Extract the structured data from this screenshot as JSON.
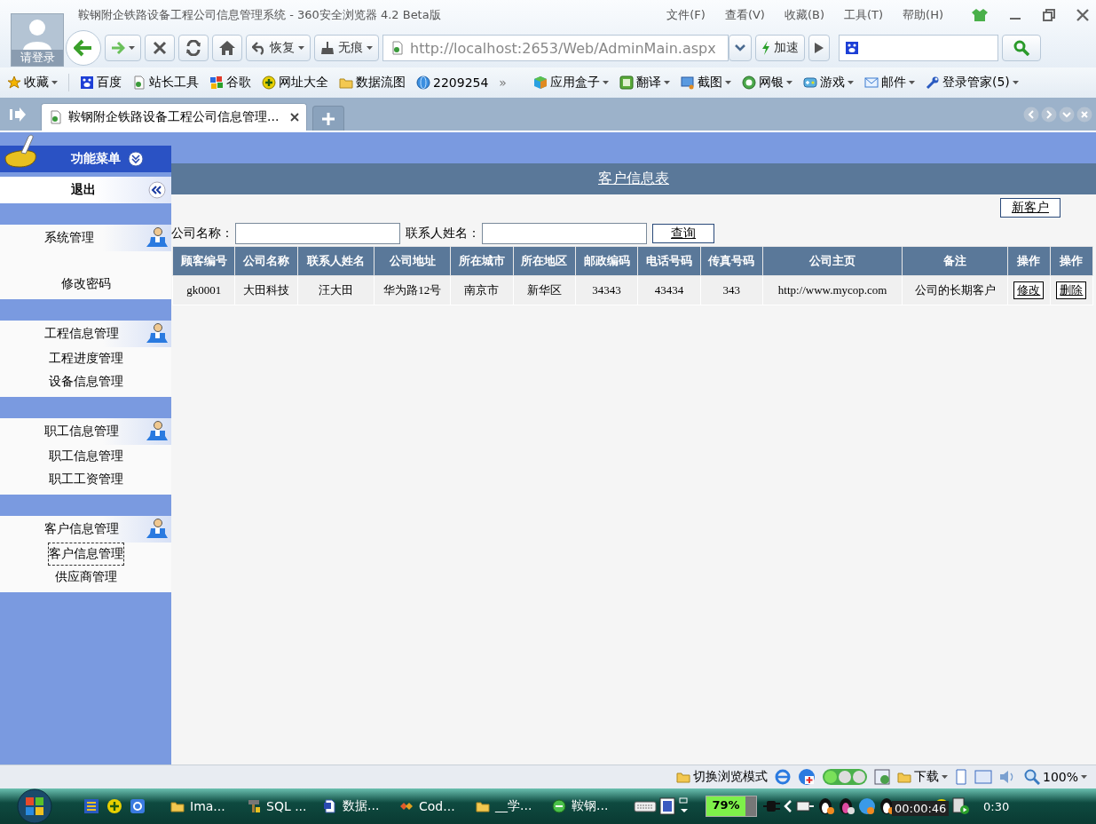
{
  "window": {
    "title": "鞍钢附企铁路设备工程公司信息管理系统 - 360安全浏览器 4.2 Beta版",
    "login": "请登录"
  },
  "menu": [
    "文件(F)",
    "查看(V)",
    "收藏(B)",
    "工具(T)",
    "帮助(H)"
  ],
  "toolbar": {
    "restore": "恢复",
    "private": "无痕",
    "address": "http://localhost:2653/Web/AdminMain.aspx",
    "speedup": "加速"
  },
  "bookmarks": [
    {
      "label": "收藏",
      "kind": "star",
      "dropdown": true
    },
    {
      "label": "百度",
      "kind": "paw",
      "dropdown": false
    },
    {
      "label": "站长工具",
      "kind": "page",
      "dropdown": false
    },
    {
      "label": "谷歌",
      "kind": "blocks",
      "dropdown": false
    },
    {
      "label": "网址大全",
      "kind": "plus",
      "dropdown": false
    },
    {
      "label": "数据流图",
      "kind": "folder",
      "dropdown": false
    },
    {
      "label": "2209254",
      "kind": "globe",
      "dropdown": false
    },
    {
      "label": "»",
      "kind": "more",
      "dropdown": false
    },
    {
      "label": "应用盒子",
      "kind": "cube",
      "dropdown": true
    },
    {
      "label": "翻译",
      "kind": "tile",
      "dropdown": true
    },
    {
      "label": "截图",
      "kind": "monitor",
      "dropdown": true
    },
    {
      "label": "网银",
      "kind": "coin",
      "dropdown": true
    },
    {
      "label": "游戏",
      "kind": "gamepad",
      "dropdown": true
    },
    {
      "label": "邮件",
      "kind": "mail",
      "dropdown": true
    },
    {
      "label": "登录管家(5)",
      "kind": "wrench",
      "dropdown": true
    }
  ],
  "tabs": [
    {
      "label": "鞍钢附企铁路设备工程公司信息管理...",
      "selected": true
    }
  ],
  "sidebar": {
    "header": "功能菜单",
    "logout": "退出",
    "groups": [
      {
        "title": "系统管理",
        "items": [
          {
            "label": "修改密码",
            "selected": false
          }
        ]
      },
      {
        "title": "工程信息管理",
        "items": [
          {
            "label": "工程进度管理",
            "selected": false
          },
          {
            "label": "设备信息管理",
            "selected": false
          }
        ]
      },
      {
        "title": "职工信息管理",
        "items": [
          {
            "label": "职工信息管理",
            "selected": false
          },
          {
            "label": "职工工资管理",
            "selected": false
          }
        ]
      },
      {
        "title": "客户信息管理",
        "items": [
          {
            "label": "客户信息管理",
            "selected": true
          },
          {
            "label": "供应商管理",
            "selected": false
          }
        ]
      }
    ]
  },
  "page": {
    "title": "客户信息表",
    "new_button": "新客户",
    "filters": [
      "公司名称：",
      "联系人姓名："
    ],
    "search_button": "查询",
    "table": {
      "columns": [
        "顾客编号",
        "公司名称",
        "联系人姓名",
        "公司地址",
        "所在城市",
        "所在地区",
        "邮政编码",
        "电话号码",
        "传真号码",
        "公司主页",
        "备注",
        "操作",
        "操作"
      ],
      "rows": [
        {
          "cells": [
            "gk0001",
            "大田科技",
            "汪大田",
            "华为路12号",
            "南京市",
            "新华区",
            "34343",
            "43434",
            "343",
            "http://www.mycop.com",
            "公司的长期客户"
          ],
          "actions": [
            "修改",
            "删除"
          ]
        }
      ]
    }
  },
  "status_bar": {
    "mode": "切换浏览模式",
    "download": "下载",
    "zoom": "100%"
  },
  "taskbar": {
    "apps": [
      {
        "label": "Ima...",
        "kind": "folder"
      },
      {
        "label": "SQL ...",
        "kind": "tool"
      },
      {
        "label": "数据...",
        "kind": "doc"
      },
      {
        "label": "Cod...",
        "kind": "code"
      },
      {
        "label": "__学...",
        "kind": "folder"
      },
      {
        "label": "鞍钢...",
        "kind": "browser"
      }
    ],
    "battery": {
      "reading": "79%",
      "level": 0.79
    },
    "tooltip": "00:00:46",
    "clock": "0:30"
  }
}
